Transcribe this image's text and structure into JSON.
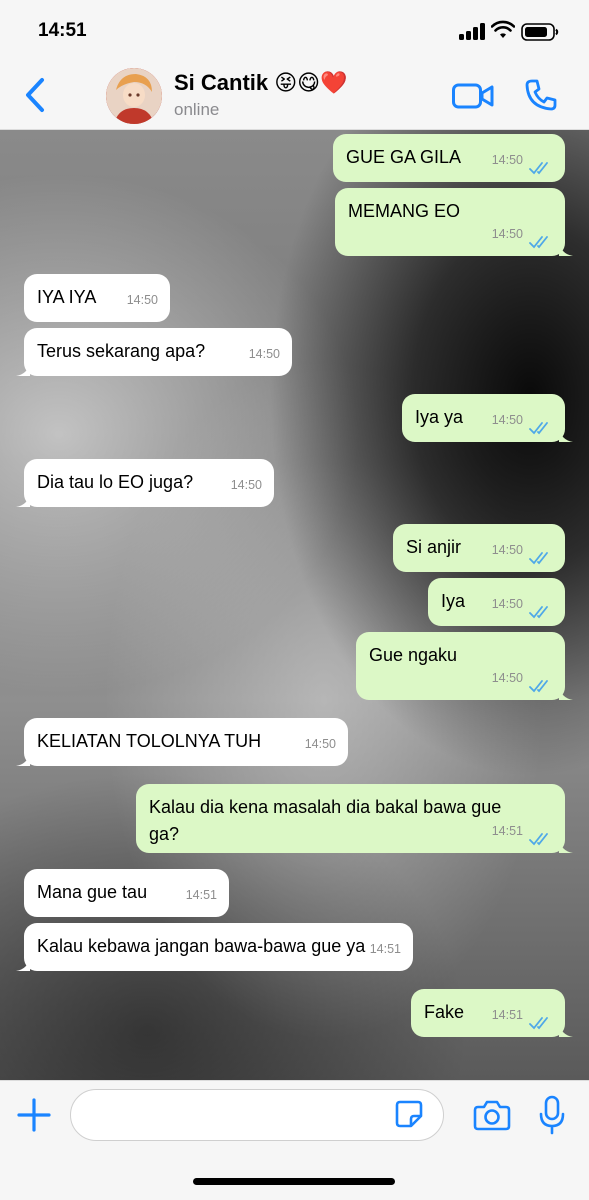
{
  "status_bar": {
    "time": "14:51"
  },
  "header": {
    "contact_name": "Si Cantik 😝😋❤️",
    "contact_status": "online"
  },
  "colors": {
    "accent": "#1a84ff",
    "bubble_out": "#dcf8c6",
    "bubble_in": "#ffffff",
    "read_ticks": "#4fa8e8"
  },
  "icons": [
    "chevron-left-icon",
    "video-icon",
    "phone-icon",
    "plus-icon",
    "sticker-icon",
    "camera-icon",
    "microphone-icon",
    "double-check-icon"
  ],
  "messages": [
    {
      "dir": "out",
      "text": "GUE GA GILA",
      "time": "14:50",
      "read": true
    },
    {
      "dir": "out",
      "text": "MEMANG EO",
      "time": "14:50",
      "read": true
    },
    {
      "dir": "in",
      "text": "IYA IYA",
      "time": "14:50"
    },
    {
      "dir": "in",
      "text": "Terus sekarang apa?",
      "time": "14:50"
    },
    {
      "dir": "out",
      "text": "Iya ya",
      "time": "14:50",
      "read": true
    },
    {
      "dir": "in",
      "text": "Dia tau lo EO juga?",
      "time": "14:50"
    },
    {
      "dir": "out",
      "text": "Si anjir",
      "time": "14:50",
      "read": true
    },
    {
      "dir": "out",
      "text": "Iya",
      "time": "14:50",
      "read": true
    },
    {
      "dir": "out",
      "text": "Gue ngaku",
      "time": "14:50",
      "read": true
    },
    {
      "dir": "in",
      "text": "KELIATAN TOLOLNYA TUH",
      "time": "14:50"
    },
    {
      "dir": "out",
      "text": "Kalau dia kena masalah dia bakal bawa gue ga?",
      "time": "14:51",
      "read": true
    },
    {
      "dir": "in",
      "text": "Mana gue tau",
      "time": "14:51"
    },
    {
      "dir": "in",
      "text": "Kalau kebawa jangan bawa-bawa gue ya",
      "time": "14:51"
    },
    {
      "dir": "out",
      "text": "Fake",
      "time": "14:51",
      "read": true
    }
  ],
  "input": {
    "placeholder": ""
  }
}
